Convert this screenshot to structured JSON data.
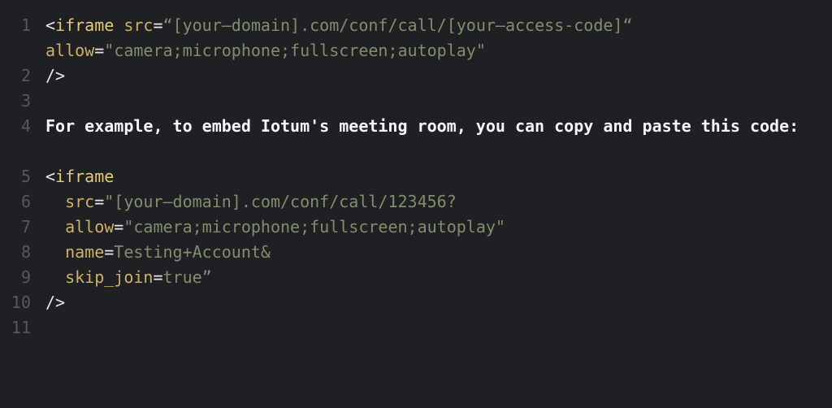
{
  "gutter": {
    "lines": [
      "1",
      "2",
      "3",
      "4",
      "5",
      "6",
      "7",
      "8",
      "9",
      "10",
      "11"
    ]
  },
  "line1": {
    "open": "<",
    "tag": "iframe",
    "sp": " ",
    "attr": "src",
    "eq": "=",
    "q1": "“",
    "str": "[your–domain].com/conf/call/[your–access-code]",
    "q2": "“",
    "sp2": " ",
    "attr2": "allow",
    "eq2": "=",
    "q3": "\"",
    "str2": "camera;microphone;fullscreen;autoplay",
    "q4": "\""
  },
  "line2": {
    "close": "/>"
  },
  "line4": "For example, to embed Iotum's meeting room, you can copy and paste this code:",
  "line6": {
    "open": "<",
    "tag": "iframe"
  },
  "line7": {
    "attr": "src",
    "eq": "=",
    "q1": "\"",
    "str": "[your–domain].com/conf/call/123456?"
  },
  "line8": {
    "attr": "allow",
    "eq": "=",
    "q1": "\"",
    "str": "camera;microphone;fullscreen;autoplay",
    "q2": "\""
  },
  "line9": {
    "attr": "name",
    "eq": "=",
    "str": "Testing+Account&"
  },
  "line10": {
    "attr": "skip_join",
    "eq": "=",
    "str": "true",
    "q2": "”"
  },
  "line11": {
    "close": "/>"
  }
}
